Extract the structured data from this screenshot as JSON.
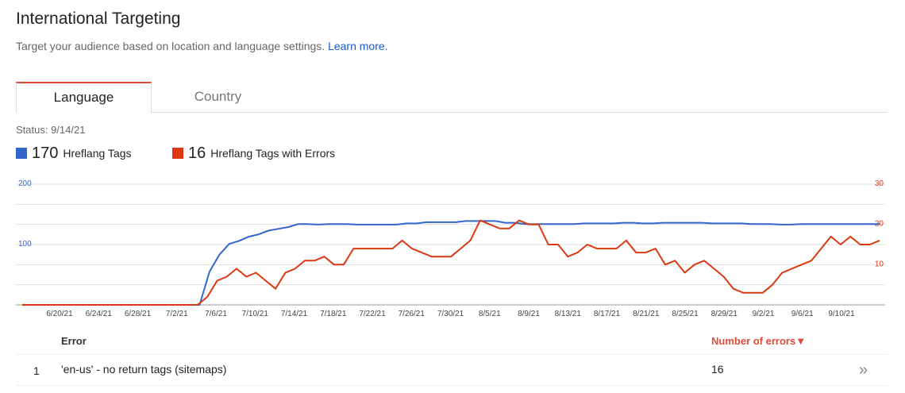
{
  "page": {
    "title": "International Targeting",
    "subtitle": "Target your audience based on location and language settings.",
    "learn_more": "Learn more."
  },
  "tabs": [
    {
      "label": "Language",
      "active": true
    },
    {
      "label": "Country",
      "active": false
    }
  ],
  "status": "Status: 9/14/21",
  "legend": [
    {
      "value": "170",
      "label": "Hreflang Tags",
      "color": "#3366cc"
    },
    {
      "value": "16",
      "label": "Hreflang Tags with Errors",
      "color": "#dc3912"
    }
  ],
  "chart_data": {
    "type": "line",
    "x_tick_labels": [
      "6/20/21",
      "6/24/21",
      "6/28/21",
      "7/2/21",
      "7/6/21",
      "7/10/21",
      "7/14/21",
      "7/18/21",
      "7/22/21",
      "7/26/21",
      "7/30/21",
      "8/5/21",
      "8/9/21",
      "8/13/21",
      "8/17/21",
      "8/21/21",
      "8/25/21",
      "8/29/21",
      "9/2/21",
      "9/6/21",
      "9/10/21"
    ],
    "left_axis": {
      "ticks": [
        "200",
        "100"
      ],
      "ylim": [
        0,
        200
      ],
      "color": "#3366cc"
    },
    "right_axis": {
      "ticks": [
        "30",
        "20",
        "10"
      ],
      "ylim": [
        0,
        30
      ],
      "color": "#dc3912"
    },
    "series": [
      {
        "name": "Hreflang Tags",
        "axis": "left",
        "color": "#3366cc",
        "values": [
          0,
          0,
          0,
          0,
          0,
          0,
          0,
          0,
          0,
          0,
          0,
          0,
          0,
          0,
          0,
          0,
          0,
          0,
          0,
          55,
          83,
          101,
          106,
          113,
          117,
          123,
          126,
          129,
          134,
          134,
          133,
          134,
          134,
          134,
          133,
          133,
          133,
          133,
          133,
          135,
          135,
          137,
          137,
          137,
          137,
          139,
          139,
          139,
          139,
          136,
          136,
          134,
          134,
          134,
          134,
          134,
          134,
          135,
          135,
          135,
          135,
          136,
          136,
          135,
          135,
          136,
          136,
          136,
          136,
          136,
          135,
          135,
          135,
          135,
          134,
          134,
          134,
          133,
          133,
          134,
          134,
          134,
          134,
          134,
          134,
          134,
          134,
          134
        ]
      },
      {
        "name": "Hreflang Tags with Errors",
        "axis": "right",
        "color": "#dc3912",
        "values": [
          0,
          0,
          0,
          0,
          0,
          0,
          0,
          0,
          0,
          0,
          0,
          0,
          0,
          0,
          0,
          0,
          0,
          0,
          0,
          2,
          6,
          7,
          9,
          7,
          8,
          6,
          4,
          8,
          9,
          11,
          11,
          12,
          10,
          10,
          14,
          14,
          14,
          14,
          14,
          16,
          14,
          13,
          12,
          12,
          12,
          14,
          16,
          21,
          20,
          19,
          19,
          21,
          20,
          20,
          15,
          15,
          12,
          13,
          15,
          14,
          14,
          14,
          16,
          13,
          13,
          14,
          10,
          11,
          8,
          10,
          11,
          9,
          7,
          4,
          3,
          3,
          3,
          5,
          8,
          9,
          10,
          11,
          14,
          17,
          15,
          17,
          15,
          15,
          16
        ]
      }
    ]
  },
  "table": {
    "col_error": "Error",
    "col_num": "Number of errors",
    "sort_indicator": "▼",
    "rows": [
      {
        "index": "1",
        "error": "'en-us' - no return tags (sitemaps)",
        "count": "16"
      }
    ],
    "row_action_glyph": "»"
  }
}
